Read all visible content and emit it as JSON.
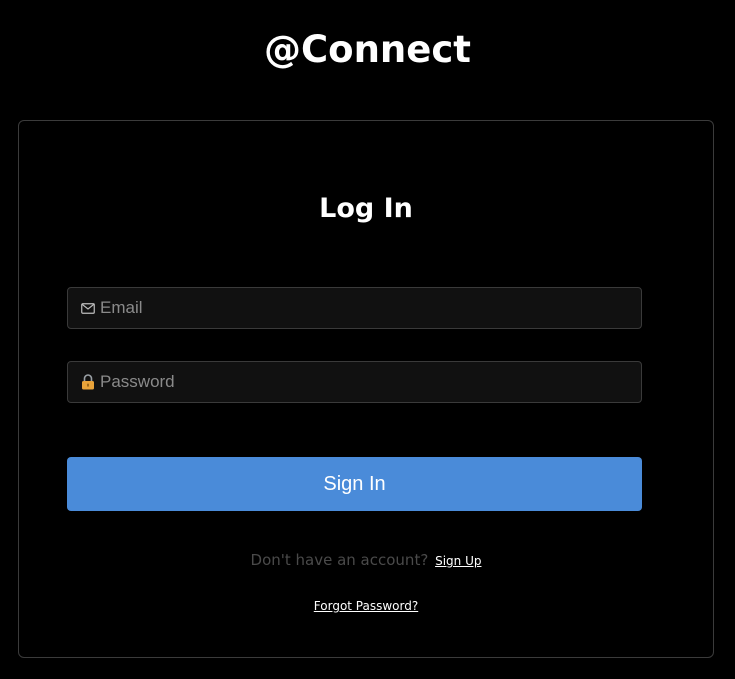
{
  "app": {
    "title": "@Connect"
  },
  "login": {
    "heading": "Log In",
    "email_placeholder": "Email",
    "email_value": "",
    "password_placeholder": "Password",
    "password_value": "",
    "submit_label": "Sign In",
    "signup_prompt": "Don't have an account?",
    "signup_link": "Sign Up",
    "forgot_link": "Forgot Password?"
  },
  "icons": {
    "email": "mail-icon",
    "password": "lock-icon"
  },
  "colors": {
    "background": "#000000",
    "card_border": "#3b3b3b",
    "input_bg": "#111111",
    "primary_button": "#4a8bd9",
    "muted_text": "#4a4a4a",
    "lock_body": "#e8a33a"
  }
}
